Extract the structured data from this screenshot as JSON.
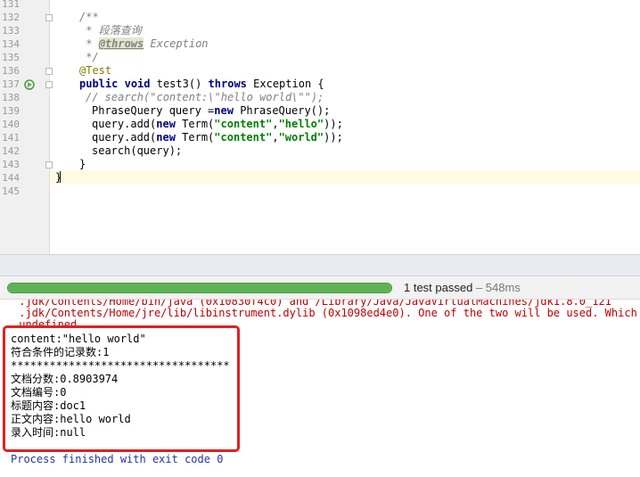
{
  "editor": {
    "line_numbers": [
      "131",
      "132",
      "133",
      "134",
      "135",
      "136",
      "137",
      "138",
      "139",
      "140",
      "141",
      "142",
      "143",
      "144",
      "145"
    ],
    "code": {
      "l132": "/**",
      "l133_prefix": " * ",
      "l133_text": "段落查询",
      "l134_prefix": " * ",
      "l134_tag": "@throws",
      "l134_rest": " Exception",
      "l135": " */",
      "l136": "@Test",
      "l137_kw1": "public",
      "l137_kw2": "void",
      "l137_name": "test3()",
      "l137_kw3": "throws",
      "l137_rest": "Exception {",
      "l138": "// search(\"content:\\\"hello world\\\"\");",
      "l139_a": "PhraseQuery query =",
      "l139_kw": "new",
      "l139_b": " PhraseQuery();",
      "l140_a": "query.add(",
      "l140_kw": "new",
      "l140_b": " Term(",
      "l140_s1": "\"content\"",
      "l140_c": ",",
      "l140_s2": "\"hello\"",
      "l140_d": "));",
      "l141_a": "query.add(",
      "l141_kw": "new",
      "l141_b": " Term(",
      "l141_s1": "\"content\"",
      "l141_c": ",",
      "l141_s2": "\"world\"",
      "l141_d": "));",
      "l142": "search(query);",
      "l143": "}",
      "l144": "}"
    }
  },
  "test_runner": {
    "progress": 1.0,
    "status": "1 test passed",
    "separator": " – ",
    "duration": "548ms",
    "progress_color": "#5fb357"
  },
  "console": {
    "lines": [
      " .jdk/Contents/Home/bin/java (0x10830f4c0) and /Library/Java/JavaVirtualMachines/jdk1.8.0_121",
      " .jdk/Contents/Home/jre/lib/libinstrument.dylib (0x1098ed4e0). One of the two will be used. Which one",
      " undefined.",
      "content:\"hello world\"",
      "符合条件的记录数:1",
      "**********************************",
      "文档分数:0.8903974",
      "文档编号:0",
      "标题内容:doc1",
      "正文内容:hello world",
      "录入时间:null",
      "",
      "Process finished with exit code 0"
    ],
    "highlight_color": "#e02020"
  }
}
